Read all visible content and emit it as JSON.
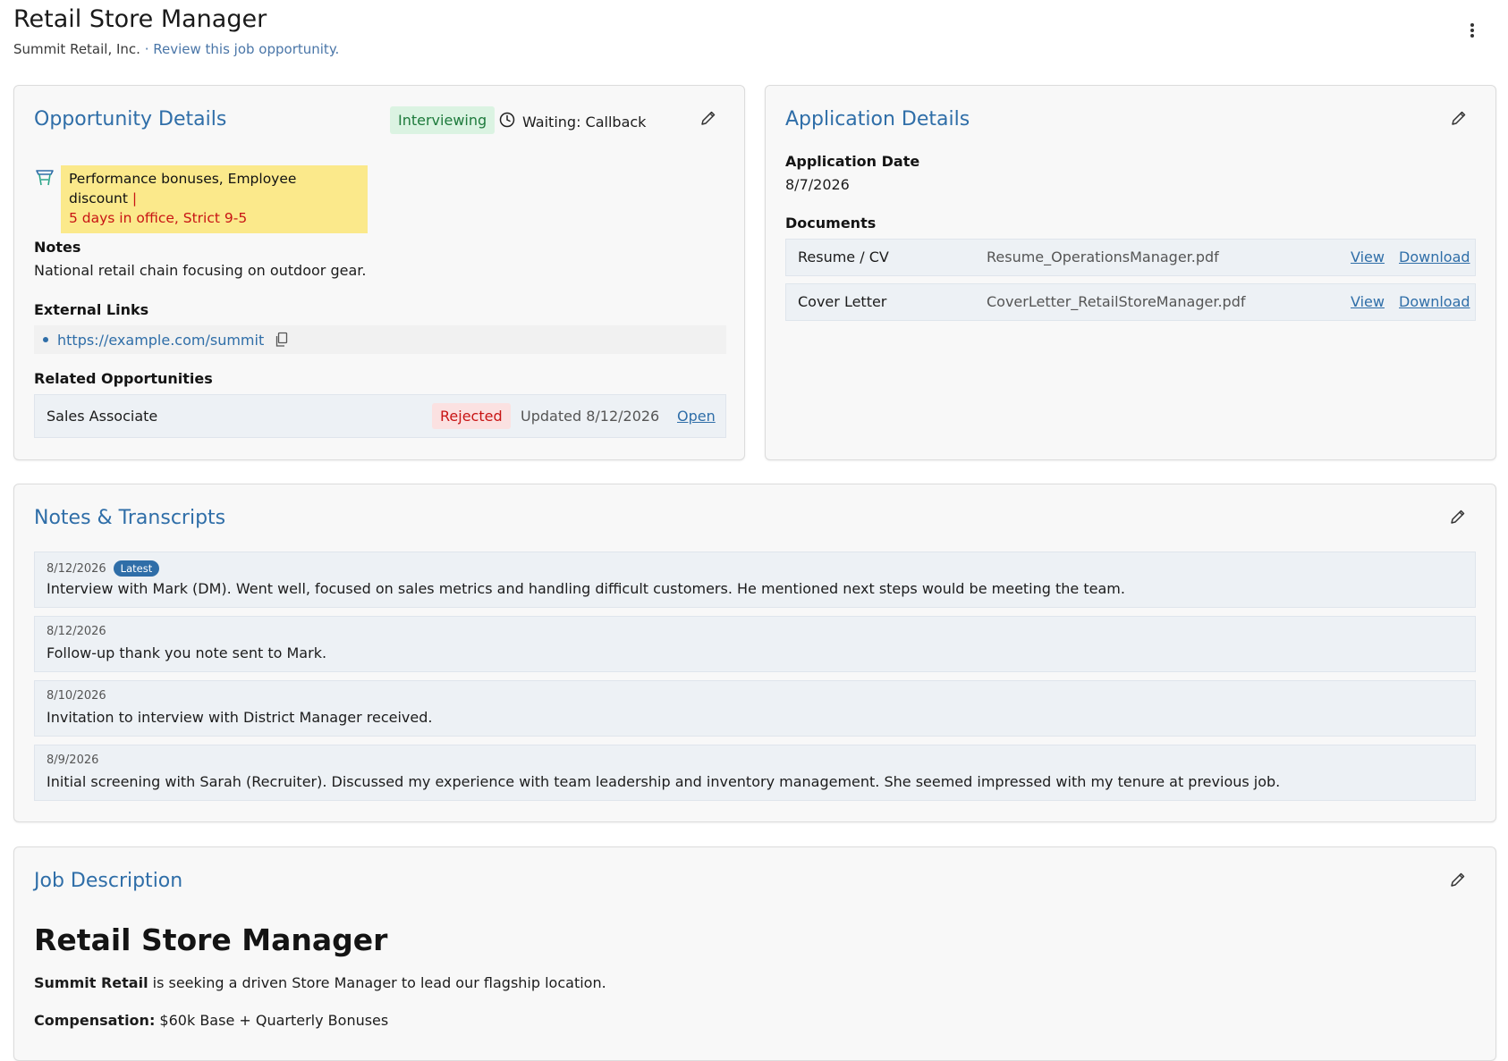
{
  "header": {
    "title": "Retail Store Manager",
    "company": "Summit Retail, Inc.",
    "separator": " · ",
    "hint": "Review this job opportunity."
  },
  "opportunity": {
    "title": "Opportunity Details",
    "status": "Interviewing",
    "waiting": "Waiting: Callback",
    "perks": "Performance bonuses, Employee discount",
    "perks_divider": " |",
    "constraints": "5 days in office, Strict 9-5",
    "notes_label": "Notes",
    "notes": "National retail chain focusing on outdoor gear.",
    "links_label": "External Links",
    "links": [
      "https://example.com/summit"
    ],
    "related_label": "Related Opportunities",
    "related": [
      {
        "name": "Sales Associate",
        "status": "Rejected",
        "updated": "Updated 8/12/2026",
        "action": "Open"
      }
    ]
  },
  "application": {
    "title": "Application Details",
    "date_label": "Application Date",
    "date": "8/7/2026",
    "documents_label": "Documents",
    "documents": [
      {
        "type": "Resume / CV",
        "file": "Resume_OperationsManager.pdf",
        "view": "View",
        "download": "Download"
      },
      {
        "type": "Cover Letter",
        "file": "CoverLetter_RetailStoreManager.pdf",
        "view": "View",
        "download": "Download"
      }
    ]
  },
  "notes_section": {
    "title": "Notes & Transcripts",
    "latest_badge": "Latest",
    "items": [
      {
        "date": "8/12/2026",
        "text": "Interview with Mark (DM). Went well, focused on sales metrics and handling difficult customers. He mentioned next steps would be meeting the team."
      },
      {
        "date": "8/12/2026",
        "text": "Follow-up thank you note sent to Mark."
      },
      {
        "date": "8/10/2026",
        "text": "Invitation to interview with District Manager received."
      },
      {
        "date": "8/9/2026",
        "text": "Initial screening with Sarah (Recruiter). Discussed my experience with team leadership and inventory management. She seemed impressed with my tenure at previous job."
      }
    ]
  },
  "job_description": {
    "title": "Job Description",
    "heading": "Retail Store Manager",
    "company_bold": "Summit Retail",
    "intro_rest": " is seeking a driven Store Manager to lead our flagship location.",
    "comp_label": "Compensation:",
    "comp_value": " $60k Base + Quarterly Bonuses"
  },
  "colors": {
    "accent": "#2f6ea8",
    "interviewing_bg": "#dbf3e2",
    "interviewing_text": "#1e7a3c",
    "rejected_bg": "#fbe1e1",
    "rejected_text": "#c81414",
    "perks_bg": "#fbe98b"
  },
  "icons": [
    "kebab-menu-icon",
    "clock-icon",
    "pencil-icon",
    "gift-basket-icon",
    "copy-icon"
  ]
}
